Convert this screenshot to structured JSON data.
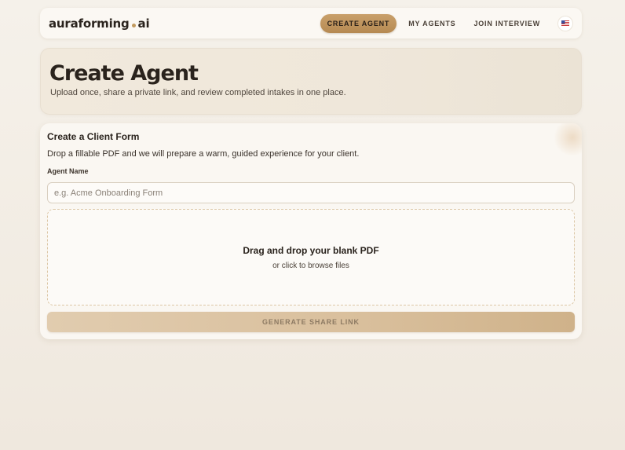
{
  "header": {
    "logo_main": "auraforming",
    "logo_suffix": "ai",
    "nav": [
      {
        "label": "CREATE AGENT",
        "active": true
      },
      {
        "label": "MY AGENTS",
        "active": false
      },
      {
        "label": "JOIN INTERVIEW",
        "active": false
      }
    ],
    "language_icon": "us-flag-icon"
  },
  "hero": {
    "title": "Create Agent",
    "subtitle": "Upload once, share a private link, and review completed intakes in one place."
  },
  "form": {
    "title": "Create a Client Form",
    "description": "Drop a fillable PDF and we will prepare a warm, guided experience for your client.",
    "agent_name_label": "Agent Name",
    "agent_name_placeholder": "e.g. Acme Onboarding Form",
    "agent_name_value": "",
    "dropzone_title": "Drag and drop your blank PDF",
    "dropzone_subtitle": "or click to browse files",
    "submit_label": "GENERATE SHARE LINK"
  },
  "colors": {
    "accent": "#c29a5e",
    "background": "#f3eee6",
    "text": "#2a231d"
  }
}
